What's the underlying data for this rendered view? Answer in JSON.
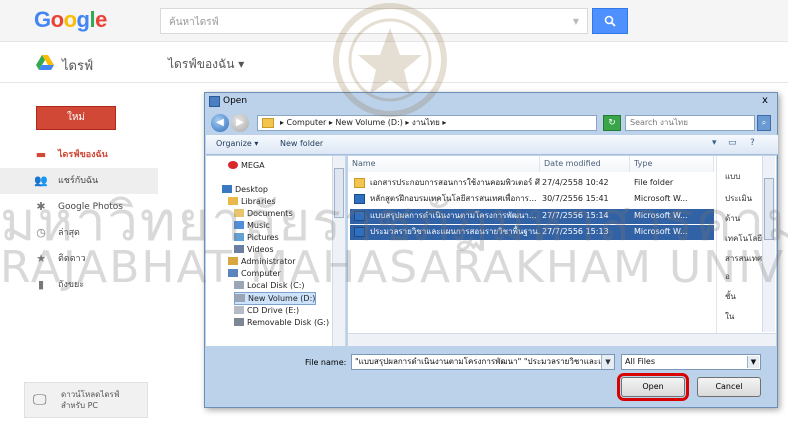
{
  "google": {
    "logo_letters": [
      "G",
      "o",
      "o",
      "g",
      "l",
      "e"
    ],
    "search_placeholder": "ค้นหาไดรฟ์",
    "search_button_icon": "search-icon"
  },
  "drive": {
    "title": "ไดรฟ์",
    "my_drive": "ไดรฟ์ของฉัน",
    "my_drive_caret": "▾"
  },
  "sidebar": {
    "new_label": "ใหม่",
    "items": [
      {
        "label": "ไดรฟ์ของฉัน",
        "icon": "folder-icon"
      },
      {
        "label": "แชร์กับฉัน",
        "icon": "people-icon"
      },
      {
        "label": "Google Photos",
        "icon": "photos-icon"
      },
      {
        "label": "ล่าสุด",
        "icon": "clock-icon"
      },
      {
        "label": "ติดดาว",
        "icon": "star-icon"
      },
      {
        "label": "ถังขยะ",
        "icon": "trash-icon"
      }
    ],
    "pc_label_1": "ดาวน์โหลดไดรฟ์",
    "pc_label_2": "สำหรับ PC"
  },
  "dialog": {
    "title": "Open",
    "close": "x",
    "address": "▸ Computer ▸ New Volume (D:) ▸ งานไทย ▸",
    "search_placeholder": "Search งานไทย",
    "toolbar": {
      "organize": "Organize ▾",
      "new_folder": "New folder"
    },
    "tree": [
      {
        "label": "MEGA",
        "icon": "mega-icon"
      },
      {
        "label": "Desktop",
        "icon": "desktop-icon"
      },
      {
        "label": "Libraries",
        "icon": "library-icon"
      },
      {
        "label": "Documents",
        "icon": "documents-icon"
      },
      {
        "label": "Music",
        "icon": "music-icon"
      },
      {
        "label": "Pictures",
        "icon": "pictures-icon"
      },
      {
        "label": "Videos",
        "icon": "videos-icon"
      },
      {
        "label": "Administrator",
        "icon": "user-icon"
      },
      {
        "label": "Computer",
        "icon": "computer-icon"
      },
      {
        "label": "Local Disk (C:)",
        "icon": "disk-icon"
      },
      {
        "label": "New Volume (D:)",
        "icon": "disk-icon"
      },
      {
        "label": "CD Drive (E:)",
        "icon": "cd-icon"
      },
      {
        "label": "Removable Disk (G:)",
        "icon": "usb-icon"
      }
    ],
    "columns": {
      "name": "Name",
      "date": "Date modified",
      "type": "Type"
    },
    "files": [
      {
        "name": "เอกสารประกอบการสอนการใช้งานคอมพิวเตอร์ ศึกษ...",
        "date": "27/4/2558 10:42",
        "type": "File folder",
        "kind": "folder"
      },
      {
        "name": "หลักสูตรฝึกอบรมเทคโนโลยีสารสนเทศเพื่อการ...",
        "date": "30/7/2556 15:41",
        "type": "Microsoft W...",
        "kind": "doc"
      },
      {
        "name": "แบบสรุปผลการดำเนินงานตามโครงการพัฒนา...",
        "date": "27/7/2556 15:14",
        "type": "Microsoft W...",
        "kind": "doc"
      },
      {
        "name": "ประมวลรายวิชาและแผนการสอนรายวิชาพื้นฐาน...",
        "date": "27/7/2556 15:13",
        "type": "Microsoft W...",
        "kind": "doc"
      }
    ],
    "strip_text": [
      "แบบ",
      "ประเมิน",
      "ด้าน",
      "เทคโนโลยี",
      "สารสนเทศ",
      "อ",
      "ชั้น",
      "ใน"
    ],
    "file_name_label": "File name:",
    "file_name_value": "\"แบบสรุปผลการดำเนินงานตามโครงการพัฒนา\" \"ประมวลรายวิชาและแผนการสอนรายวิชาพื้นฐาน\"",
    "file_type": "All Files",
    "open_label": "Open",
    "cancel_label": "Cancel"
  },
  "watermark": {
    "line1": "มหาวิทยาลัยราชภัฏมหาสารคาม",
    "line2": "RAJABHAT MAHASARAKHAM UNIVERSITY"
  }
}
